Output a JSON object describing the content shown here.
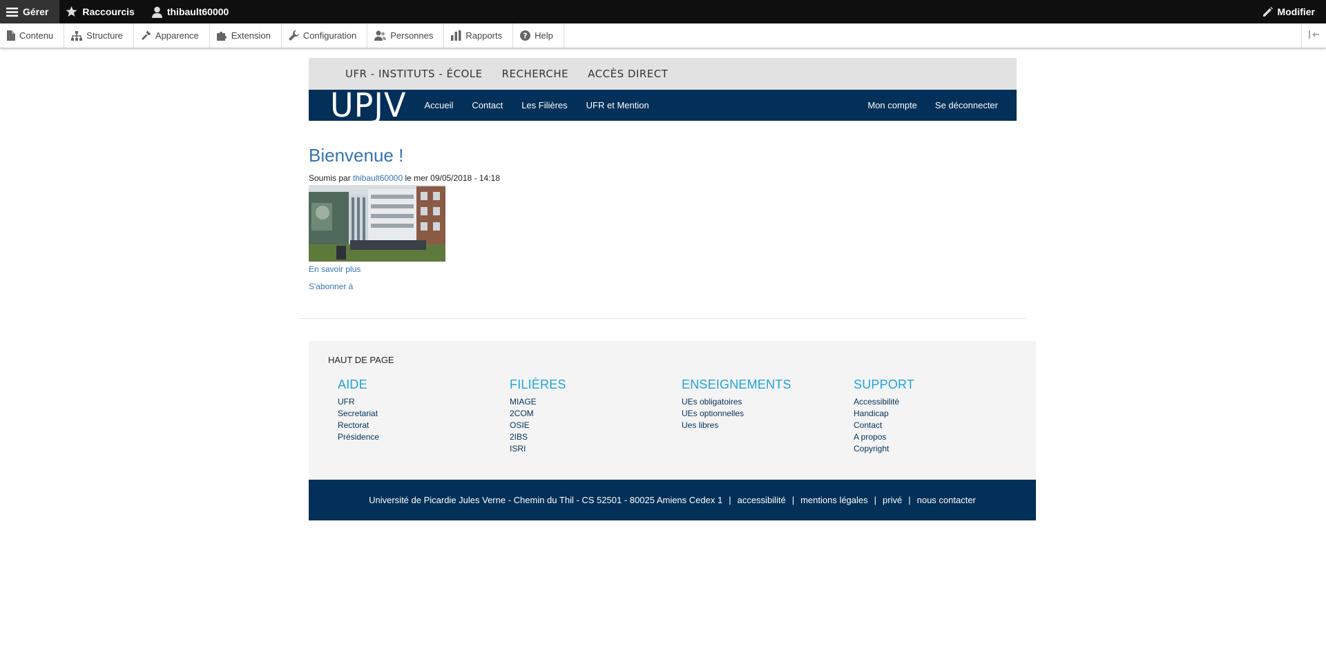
{
  "admin_bar": {
    "manage": "Gérer",
    "shortcuts": "Raccourcis",
    "user": "thibault60000",
    "edit": "Modifier"
  },
  "tray": {
    "items": [
      "Contenu",
      "Structure",
      "Apparence",
      "Extension",
      "Configuration",
      "Personnes",
      "Rapports",
      "Help"
    ]
  },
  "site": {
    "topnav": [
      "UFR - INSTITUTS - ÉCOLE",
      "RECHERCHE",
      "ACCÈS DIRECT"
    ],
    "logo": "UPJV",
    "mainnav": [
      "Accueil",
      "Contact",
      "Les Filières",
      "UFR et Mention"
    ],
    "usernav": [
      "Mon compte",
      "Se déconnecter"
    ],
    "brand_color": "#023058"
  },
  "content": {
    "title": "Bienvenue !",
    "submitted_prefix": "Soumis par",
    "author": "thibault60000",
    "submitted_suffix": "le mer 09/05/2018 - 14:18",
    "more": "En savoir plus",
    "feed": "S'abonner à"
  },
  "footer": {
    "back_to_top": "HAUT DE PAGE",
    "columns": [
      {
        "title": "AIDE",
        "links": [
          "UFR",
          "Secretariat",
          "Rectorat",
          "Présidence"
        ]
      },
      {
        "title": "FILIÈRES",
        "links": [
          "MIAGE",
          "2COM",
          "OSIE",
          "2IBS",
          "ISRI"
        ]
      },
      {
        "title": "ENSEIGNEMENTS",
        "links": [
          "UEs obligatoires",
          "UEs optionnelles",
          "Ues libres"
        ]
      },
      {
        "title": "SUPPORT",
        "links": [
          "Accessibilité",
          "Handicap",
          "Contact",
          "A propos",
          "Copyright"
        ]
      }
    ],
    "address": "Université de Picardie Jules Verne - Chemin du Thil - CS 52501 - 80025 Amiens Cedex 1",
    "bottom_links": [
      "accessibilité",
      "mentions légales",
      "privé",
      "nous contacter"
    ]
  }
}
